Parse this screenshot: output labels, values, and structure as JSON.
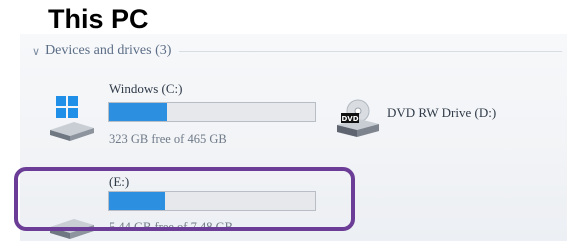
{
  "window": {
    "title": "This PC"
  },
  "group": {
    "label": "Devices and drives (3)"
  },
  "drives": [
    {
      "name": "Windows (C:)",
      "free_text": "323 GB free of 465 GB",
      "used_fraction": 0.28
    },
    {
      "name": "DVD RW Drive (D:)",
      "icon_label": "DVD"
    },
    {
      "name": "(E:)",
      "free_text": "5.44 GB free of 7.48 GB",
      "used_fraction": 0.27
    }
  ],
  "icons": {
    "c_drive": "windows-drive-icon",
    "d_drive": "dvd-drive-icon",
    "e_drive": "removable-drive-icon",
    "group_chevron": "chevron-down-icon"
  },
  "colors": {
    "bar_fill": "#2c8fe0",
    "highlight": "#6b3d96"
  }
}
